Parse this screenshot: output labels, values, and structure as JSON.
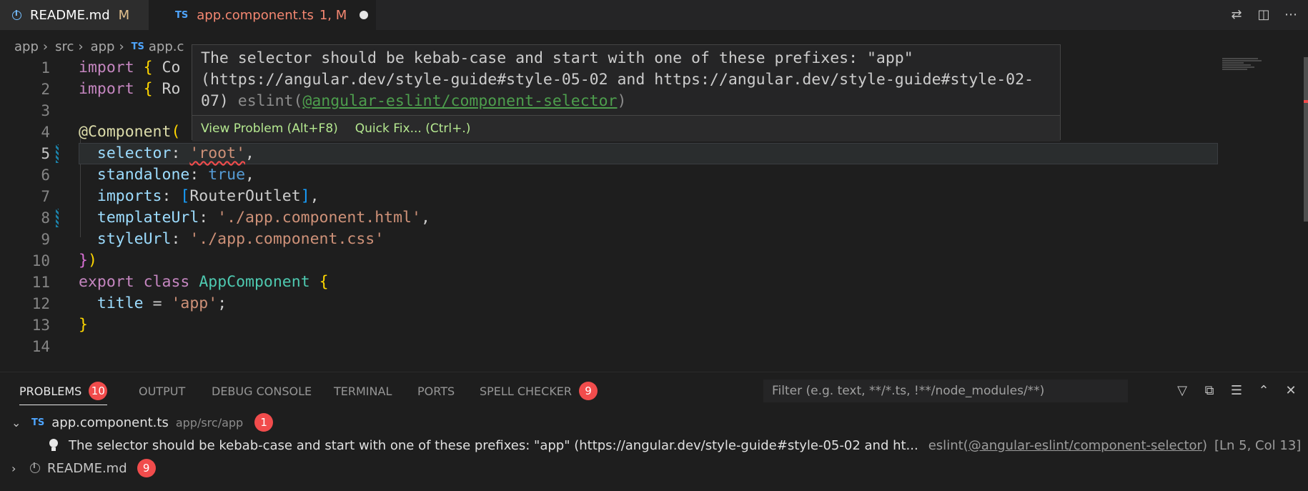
{
  "tabs": [
    {
      "label": "README.md",
      "status": "M"
    },
    {
      "badge": "TS",
      "label": "app.component.ts",
      "status": "1, M"
    }
  ],
  "breadcrumb": [
    "app",
    "src",
    "app",
    "TS",
    "app.c"
  ],
  "editor": {
    "lines": [
      "1",
      "2",
      "3",
      "4",
      "5",
      "6",
      "7",
      "8",
      "9",
      "10",
      "11",
      "12",
      "13",
      "14"
    ]
  },
  "hover": {
    "message": "The selector should be kebab-case and start with one of these prefixes: \"app\" (https://angular.dev/style-guide#style-05-02 and https://angular.dev/style-guide#style-02-07)",
    "source_prefix": "eslint(",
    "source_rule": "@angular-eslint/component-selector",
    "source_suffix": ")",
    "action_view": "View Problem (Alt+F8)",
    "action_fix": "Quick Fix... (Ctrl+.)"
  },
  "panel": {
    "tabs": [
      {
        "label": "PROBLEMS",
        "badge": "10"
      },
      {
        "label": "OUTPUT"
      },
      {
        "label": "DEBUG CONSOLE"
      },
      {
        "label": "TERMINAL"
      },
      {
        "label": "PORTS"
      },
      {
        "label": "SPELL CHECKER",
        "badge": "9"
      }
    ],
    "filter_placeholder": "Filter (e.g. text, **/*.ts, !**/node_modules/**)",
    "groups": [
      {
        "badge": "TS",
        "file": "app.component.ts",
        "path": "app/src/app",
        "count": "1"
      },
      {
        "file": "README.md",
        "count": "9"
      }
    ],
    "problem": {
      "text": "The selector should be kebab-case and start with one of these prefixes: \"app\" (https://angular.dev/style-guide#style-05-02 and ht...",
      "source_prefix": "eslint(",
      "source_rule": "@angular-eslint/component-selector",
      "source_suffix": ")",
      "location": "[Ln 5, Col 13]"
    }
  },
  "icons": {
    "error_badge_color": "#f14c4c"
  }
}
